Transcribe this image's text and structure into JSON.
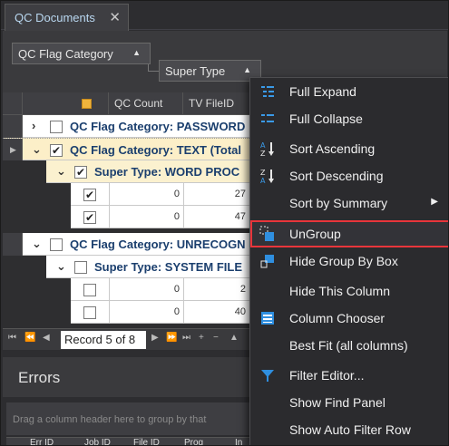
{
  "tab": {
    "title": "QC Documents",
    "close": "✕"
  },
  "group_panel": {
    "level1": {
      "label": "QC Flag Category",
      "arrow": "▲"
    },
    "level2": {
      "label": "Super Type",
      "arrow": "▲"
    }
  },
  "grid": {
    "columns": [
      "QC Count",
      "TV FileID"
    ],
    "rows": [
      {
        "kind": "group1",
        "expander": "›",
        "checked": false,
        "text": "QC Flag Category: PASSWORD"
      },
      {
        "kind": "group1",
        "expander": "⌄",
        "checked": true,
        "text": "QC Flag Category: TEXT (Total"
      },
      {
        "kind": "group2",
        "expander": "⌄",
        "checked": true,
        "text": "Super Type: WORD PROC"
      },
      {
        "kind": "data",
        "checked": true,
        "qc_count": "0",
        "file_id": "27"
      },
      {
        "kind": "data",
        "checked": true,
        "qc_count": "0",
        "file_id": "47"
      },
      {
        "kind": "group1",
        "expander": "⌄",
        "checked": false,
        "text": "QC Flag Category: UNRECOGN"
      },
      {
        "kind": "group2",
        "expander": "⌄",
        "checked": false,
        "text": "Super Type: SYSTEM FILE"
      },
      {
        "kind": "data",
        "checked": false,
        "qc_count": "0",
        "file_id": "2"
      },
      {
        "kind": "data",
        "checked": false,
        "qc_count": "0",
        "file_id": "40"
      }
    ],
    "navigator": {
      "record_text": "Record 5 of 8"
    }
  },
  "errors": {
    "title": "Errors",
    "group_hint": "Drag a column header here to group by that",
    "columns": [
      "Err ID",
      "Job ID",
      "File ID",
      "Prog",
      "In"
    ]
  },
  "context_menu": {
    "items": [
      {
        "label": "Full Expand",
        "icon": "full-expand-icon"
      },
      {
        "label": "Full Collapse",
        "icon": "full-collapse-icon"
      },
      {
        "label": "Sort Ascending",
        "icon": "sort-ascending-icon"
      },
      {
        "label": "Sort Descending",
        "icon": "sort-descending-icon"
      },
      {
        "label": "Sort by Summary",
        "icon": "",
        "submenu": "▶"
      },
      {
        "label": "UnGroup",
        "icon": "ungroup-icon",
        "highlighted": true
      },
      {
        "label": "Hide Group By Box",
        "icon": "hide-group-box-icon"
      },
      {
        "label": "Hide This Column",
        "icon": ""
      },
      {
        "label": "Column Chooser",
        "icon": "column-chooser-icon"
      },
      {
        "label": "Best Fit (all columns)",
        "icon": ""
      },
      {
        "label": "Filter Editor...",
        "icon": "filter-icon"
      },
      {
        "label": "Show Find Panel",
        "icon": ""
      },
      {
        "label": "Show Auto Filter Row",
        "icon": ""
      }
    ]
  },
  "colors": {
    "highlight_border": "#e8353b",
    "accent_blue": "#2f8fe0",
    "group_text": "#1b3f6e"
  }
}
